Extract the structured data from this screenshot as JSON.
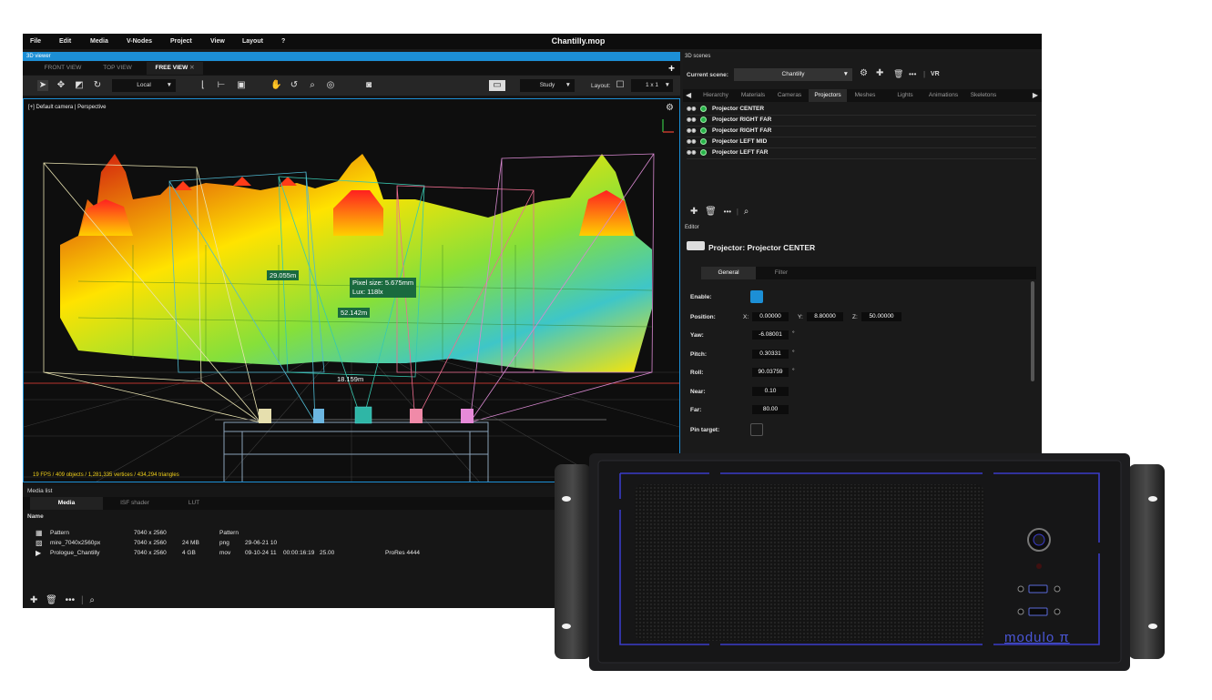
{
  "menu": [
    "File",
    "Edit",
    "Media",
    "V-Nodes",
    "Project",
    "View",
    "Layout",
    "?"
  ],
  "window_title": "Chantilly.mop",
  "viewer": {
    "title": "3D viewer",
    "tabs": [
      "FRONT VIEW",
      "TOP VIEW",
      "FREE VIEW"
    ],
    "add_label": "+",
    "space_mode": "Local",
    "study_mode": "Study",
    "layout_label": "Layout:",
    "layout_value": "1 x 1",
    "camera_label": "[+] Default camera | Perspective",
    "stats": "19 FPS / 409 objects / 1,281,335 vertices / 434,294 triangles",
    "measures": {
      "m1": "29.055m",
      "m2_line1": "Pixel size: 5.675mm",
      "m2_line2": "Lux: 118lx",
      "m3": "52.142m",
      "m4": "18.159m"
    }
  },
  "media": {
    "title": "Media list",
    "tabs": [
      "Media",
      "ISF shader",
      "LUT"
    ],
    "column_name": "Name",
    "rows": [
      {
        "name": "Pattern",
        "res": "7040 x 2560",
        "size": "",
        "type": "Pattern",
        "date": "",
        "duration": "",
        "fps": "",
        "codec": ""
      },
      {
        "name": "mire_7040x2560px",
        "res": "7040 x 2560",
        "size": "24 MB",
        "type": "png",
        "date": "29-06-21 10",
        "duration": "",
        "fps": "",
        "codec": ""
      },
      {
        "name": "Prologue_Chantilly",
        "res": "7040 x 2560",
        "size": "4 GB",
        "type": "mov",
        "date": "09-10-24 11",
        "duration": "00:00:16:19",
        "fps": "25.00",
        "codec": "ProRes 4444"
      }
    ]
  },
  "scenes": {
    "title": "3D scenes",
    "current_label": "Current scene:",
    "current_value": "Chantilly",
    "vr_label": "VR",
    "tabs": [
      "Hierarchy",
      "Materials",
      "Cameras",
      "Projectors",
      "Meshes",
      "Lights",
      "Animations",
      "Skeletons"
    ],
    "projectors": [
      "Projector CENTER",
      "Projector RIGHT FAR",
      "Projector RIGHT FAR",
      "Projector LEFT MID",
      "Projector LEFT FAR"
    ]
  },
  "editor": {
    "title": "Editor",
    "heading": "Projector: Projector CENTER",
    "tabs": [
      "General",
      "Filter"
    ],
    "enable_label": "Enable:",
    "position_label": "Position:",
    "x_label": "X:",
    "x": "0.00000",
    "y_label": "Y:",
    "y": "8.80000",
    "z_label": "Z:",
    "z": "50.00000",
    "yaw_label": "Yaw:",
    "yaw": "-6.08001",
    "pitch_label": "Pitch:",
    "pitch": "0.30331",
    "roll_label": "Roll:",
    "roll": "90.03759",
    "near_label": "Near:",
    "near": "0.10",
    "far_label": "Far:",
    "far": "80.00",
    "pin_label": "Pin target:",
    "degree": "°"
  },
  "device": {
    "brand": "modulo π"
  },
  "colors": {
    "accent": "#1c8fd6",
    "measure_bg": "#1a6a3e",
    "stats": "#f3d21c",
    "device_led": "#3a3cc8"
  }
}
